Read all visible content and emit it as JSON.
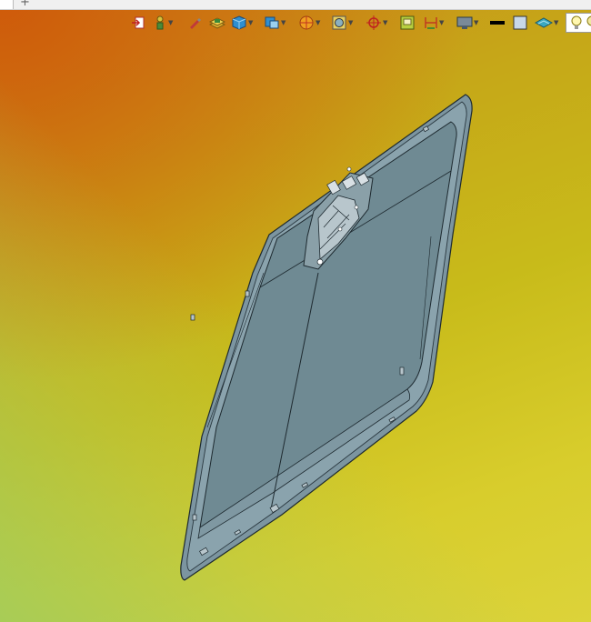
{
  "window": {
    "tab_add_glyph": "+"
  },
  "toolbar": {
    "items": [
      {
        "icon": "exit-sketch-icon"
      },
      {
        "icon": "anchor-point-icon"
      },
      {
        "icon": "pen-tool-icon"
      },
      {
        "icon": "stack-layers-icon"
      },
      {
        "icon": "cube-view-icon"
      },
      {
        "icon": "view-orientation-icon"
      },
      {
        "icon": "section-view-icon"
      },
      {
        "icon": "render-mode-icon"
      },
      {
        "icon": "axis-snap-icon"
      },
      {
        "icon": "image-frame-icon"
      },
      {
        "icon": "dimension-icon"
      },
      {
        "icon": "display-monitor-icon"
      },
      {
        "icon": "line-color-icon"
      },
      {
        "icon": "face-color-icon"
      },
      {
        "icon": "surface-icon"
      },
      {
        "icon": "lightbulb-icon"
      }
    ],
    "accent_colors": {
      "background_top_left": "#cf5a0a",
      "background_mid": "#c8bb1a",
      "background_bottom_left": "#b4d35d",
      "part_fill": "#6f8a93",
      "part_edge": "#1e2a30"
    }
  },
  "viewport": {
    "model": "window-panel-part"
  }
}
